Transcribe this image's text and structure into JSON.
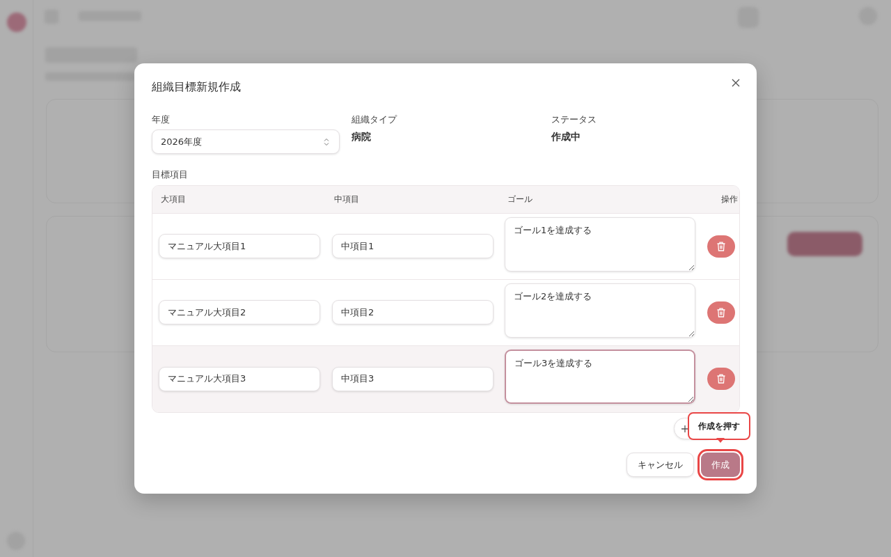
{
  "dialog": {
    "title": "組織目標新規作成",
    "fields": [
      {
        "kind": "select",
        "label": "年度",
        "value": "2026年度"
      },
      {
        "kind": "static",
        "label": "組織タイプ",
        "value": "病院"
      },
      {
        "kind": "static",
        "label": "ステータス",
        "value": "作成中"
      }
    ],
    "table": {
      "label": "目標項目",
      "columns": [
        "大項目",
        "中項目",
        "ゴール",
        "操作"
      ],
      "rows": [
        {
          "major": "マニュアル大項目1",
          "middle": "中項目1",
          "goal": "ゴール1を達成する",
          "focused": false
        },
        {
          "major": "マニュアル大項目2",
          "middle": "中項目2",
          "goal": "ゴール2を達成する",
          "focused": false
        },
        {
          "major": "マニュアル大項目3",
          "middle": "中項目3",
          "goal": "ゴール3を達成する",
          "focused": true
        }
      ]
    },
    "buttons": [
      {
        "kind": "secondary",
        "label": "キャンセル",
        "highlighted": false
      },
      {
        "kind": "primary",
        "label": "作成",
        "highlighted": true
      }
    ],
    "tooltip": "作成を押す"
  }
}
